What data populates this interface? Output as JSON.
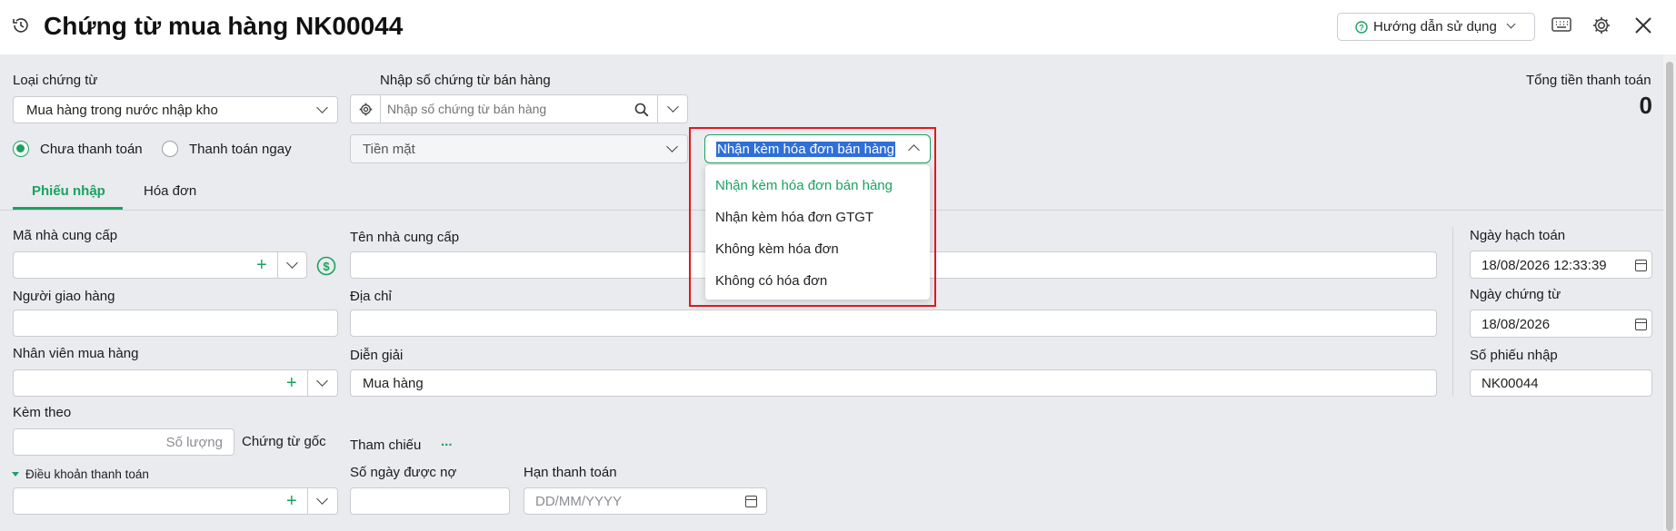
{
  "header": {
    "title": "Chứng từ mua hàng NK00044",
    "help_label": "Hướng dẫn sử dụng"
  },
  "voucher_type": {
    "label": "Loại chứng từ",
    "value": "Mua hàng trong nước nhập kho"
  },
  "sales_doc": {
    "label": "Nhập số chứng từ bán hàng",
    "placeholder": "Nhập số chứng từ bán hàng"
  },
  "total": {
    "label": "Tổng tiền thanh toán",
    "value": "0"
  },
  "payment": {
    "unpaid": "Chưa thanh toán",
    "pay_now": "Thanh toán ngay",
    "method": "Tiền mặt"
  },
  "invoice_select": {
    "value": "Nhận kèm hóa đơn bán hàng",
    "options": [
      "Nhận kèm hóa đơn bán hàng",
      "Nhận kèm hóa đơn GTGT",
      "Không kèm hóa đơn",
      "Không có hóa đơn"
    ]
  },
  "tabs": [
    "Phiếu nhập",
    "Hóa đơn"
  ],
  "form": {
    "supplier_code": "Mã nhà cung cấp",
    "supplier_name": "Tên nhà cung cấp",
    "deliverer": "Người giao hàng",
    "address": "Địa chỉ",
    "purchaser": "Nhân viên mua hàng",
    "description": "Diễn giải",
    "description_value": "Mua hàng",
    "attached": "Kèm theo",
    "quantity_placeholder": "Số lượng",
    "original_doc": "Chứng từ gốc",
    "reference": "Tham chiếu",
    "reference_more": "...",
    "payment_terms": "Điều khoản thanh toán",
    "credit_days": "Số ngày được nợ",
    "due_date": "Hạn thanh toán",
    "due_date_placeholder": "DD/MM/YYYY"
  },
  "right": {
    "posting_date_label": "Ngày hạch toán",
    "posting_date": "18/08/2026 12:33:39",
    "doc_date_label": "Ngày chứng từ",
    "doc_date": "18/08/2026",
    "receipt_no_label": "Số phiếu nhập",
    "receipt_no": "NK00044"
  },
  "colors": {
    "accent": "#1aa260",
    "highlight": "#2f6fd6",
    "alert": "#e3161b"
  }
}
